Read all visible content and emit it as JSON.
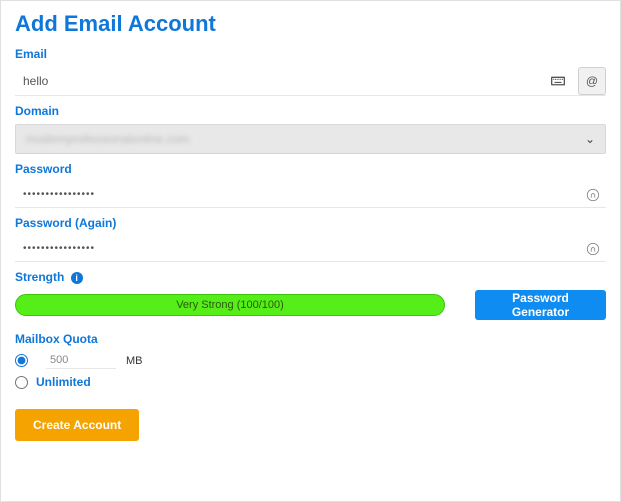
{
  "title": "Add Email Account",
  "email": {
    "label": "Email",
    "value": "hello"
  },
  "domain": {
    "label": "Domain",
    "value": "modernprofessionalonline.com"
  },
  "password": {
    "label": "Password",
    "value": "••••••••••••••••"
  },
  "password_again": {
    "label": "Password (Again)",
    "value": "••••••••••••••••"
  },
  "strength": {
    "label": "Strength",
    "text": "Very Strong (100/100)",
    "generator_label": "Password Generator"
  },
  "quota": {
    "label": "Mailbox Quota",
    "custom_value": "500",
    "unit": "MB",
    "unlimited_label": "Unlimited"
  },
  "create_label": "Create Account"
}
